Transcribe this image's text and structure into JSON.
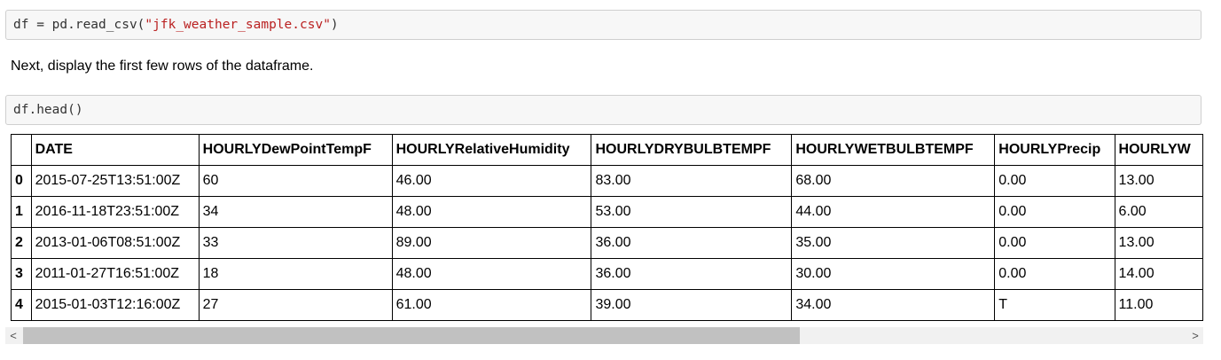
{
  "cells": [
    {
      "code_prefix": "df = pd.read_csv(",
      "code_string": "\"jfk_weather_sample.csv\"",
      "code_suffix": ")"
    },
    {
      "code": "df.head()"
    }
  ],
  "markdown": "Next, display the first few rows of the dataframe.",
  "table": {
    "columns": [
      "",
      "DATE",
      "HOURLYDewPointTempF",
      "HOURLYRelativeHumidity",
      "HOURLYDRYBULBTEMPF",
      "HOURLYWETBULBTEMPF",
      "HOURLYPrecip",
      "HOURLYW"
    ],
    "rows": [
      [
        "0",
        "2015-07-25T13:51:00Z",
        "60",
        "46.00",
        "83.00",
        "68.00",
        "0.00",
        "13.00"
      ],
      [
        "1",
        "2016-11-18T23:51:00Z",
        "34",
        "48.00",
        "53.00",
        "44.00",
        "0.00",
        "6.00"
      ],
      [
        "2",
        "2013-01-06T08:51:00Z",
        "33",
        "89.00",
        "36.00",
        "35.00",
        "0.00",
        "13.00"
      ],
      [
        "3",
        "2011-01-27T16:51:00Z",
        "18",
        "48.00",
        "36.00",
        "30.00",
        "0.00",
        "14.00"
      ],
      [
        "4",
        "2015-01-03T12:16:00Z",
        "27",
        "61.00",
        "39.00",
        "34.00",
        "T",
        "11.00"
      ]
    ]
  },
  "scrollbar": {
    "left_arrow": "<",
    "right_arrow": ">"
  }
}
